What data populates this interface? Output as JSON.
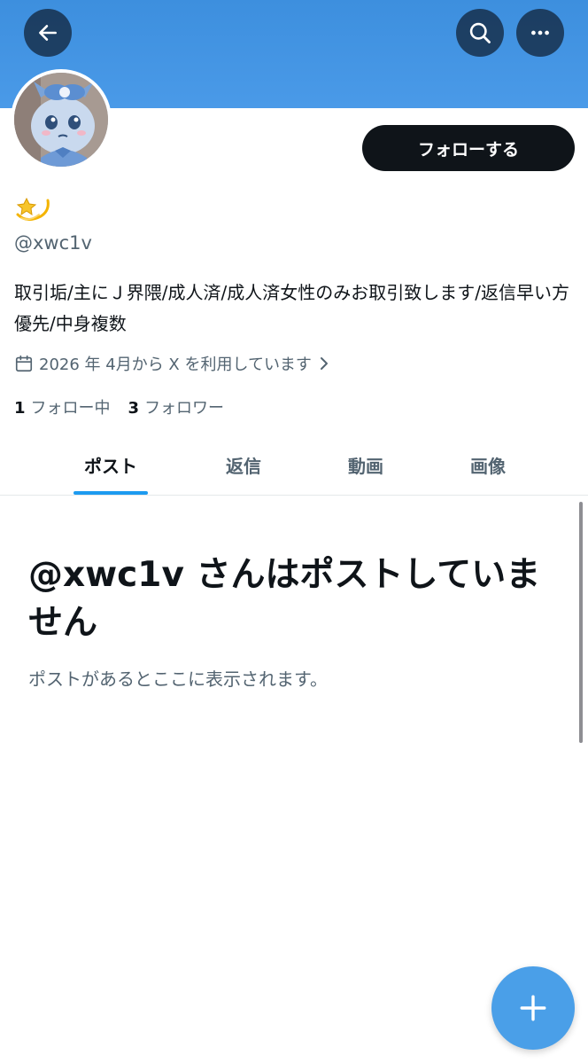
{
  "header": {
    "back_icon": "arrow-left-icon",
    "search_icon": "search-icon",
    "more_icon": "more-horizontal-icon",
    "banner_color": "#4a9ae8"
  },
  "profile": {
    "display_name_icon": "dizzy-emoji",
    "handle": "@xwc1v",
    "bio": "取引垢/主にＪ界隈/成人済/成人済女性のみお取引致します/返信早い方優先/中身複数",
    "joined": "2026 年 4月から X を利用しています",
    "following_count": "1",
    "following_label": "フォロー中",
    "followers_count": "3",
    "followers_label": "フォロワー",
    "follow_button": "フォローする"
  },
  "tabs": [
    {
      "label": "ポスト",
      "active": true
    },
    {
      "label": "返信",
      "active": false
    },
    {
      "label": "動画",
      "active": false
    },
    {
      "label": "画像",
      "active": false
    }
  ],
  "empty_state": {
    "title": "@xwc1v さんはポストしていません",
    "subtitle": "ポストがあるとここに表示されます。"
  },
  "fab": {
    "icon": "plus-icon",
    "color": "#4a9fe8"
  },
  "colors": {
    "accent": "#1d9bf0",
    "text": "#0f1419",
    "secondary": "#536471"
  }
}
